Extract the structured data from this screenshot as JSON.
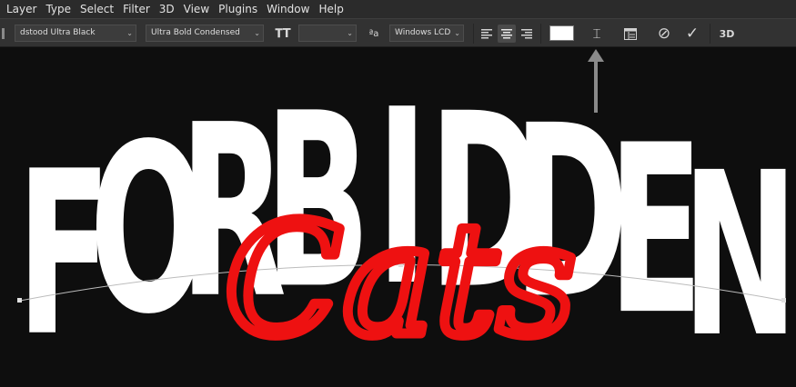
{
  "menu": [
    "Layer",
    "Type",
    "Select",
    "Filter",
    "3D",
    "View",
    "Plugins",
    "Window",
    "Help"
  ],
  "options": {
    "font_family": "dstood Ultra Black",
    "font_style": "Ultra Bold Condensed",
    "font_size": "",
    "size_icon_glyph": "𝐓T",
    "aa_icon_glyph": "ªa",
    "anti_alias": "Windows LCD",
    "warp_glyph": "⌶",
    "cancel_glyph": "⊘",
    "commit_glyph": "✓",
    "threed_label": "3D",
    "text_color": "#ffffff"
  },
  "artwork": {
    "headline": "FORBIDDEN",
    "script": "Cats",
    "headline_color": "#ffffff",
    "script_color": "#ee1111"
  }
}
